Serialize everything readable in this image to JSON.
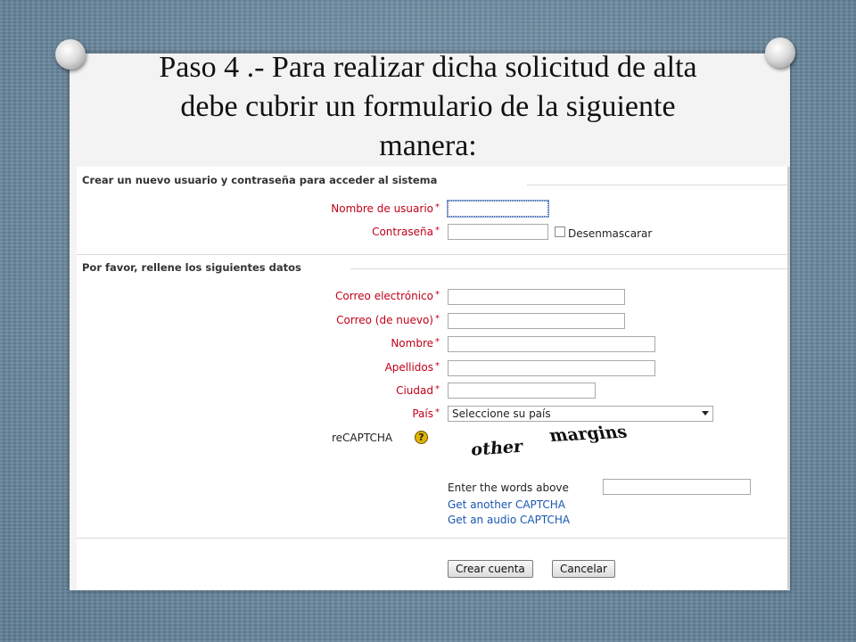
{
  "slide": {
    "title_line1": "Paso 4 .- Para realizar dicha solicitud de alta",
    "title_line2": "debe cubrir un formulario de la siguiente",
    "title_line3": "manera:"
  },
  "form": {
    "section1_title": "Crear un nuevo usuario y contraseña para acceder al sistema",
    "username_label": "Nombre de usuario",
    "password_label": "Contraseña",
    "unmask_label": "Desenmascarar",
    "section2_title": "Por favor, rellene los siguientes datos",
    "email_label": "Correo electrónico",
    "email2_label": "Correo (de nuevo)",
    "firstname_label": "Nombre",
    "lastname_label": "Apellidos",
    "city_label": "Ciudad",
    "country_label": "País",
    "country_selected": "Seleccione su país",
    "recaptcha_label": "reCAPTCHA",
    "required_mark": "*",
    "help_glyph": "?",
    "captcha_word1": "other",
    "captcha_word2": "margins",
    "captcha_prompt": "Enter the words above",
    "captcha_reload": "Get another CAPTCHA",
    "captcha_audio": "Get an audio CAPTCHA",
    "submit_label": "Crear cuenta",
    "cancel_label": "Cancelar"
  },
  "colors": {
    "label_red": "#c0001a",
    "link_blue": "#1a57b0",
    "help_yellow": "#e2b400"
  },
  "icons": {
    "help": "help-icon",
    "dropdown": "chevron-down-icon",
    "pins": "pushpin-icon"
  }
}
